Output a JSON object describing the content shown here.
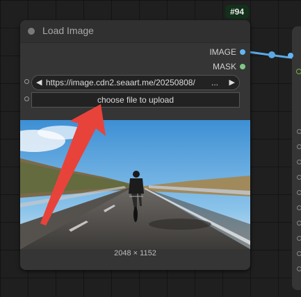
{
  "node": {
    "id_badge": "#94",
    "title": "Load Image",
    "outputs": [
      {
        "label": "IMAGE",
        "color": "#64b5f6"
      },
      {
        "label": "MASK",
        "color": "#81c784"
      }
    ],
    "image_combo": {
      "value": "https://image.cdn2.seaart.me/20250808/",
      "ellipsis": "...",
      "prev_arrow": "◀",
      "next_arrow": "▶"
    },
    "upload_button": "choose file to upload",
    "preview": {
      "dimensions_label": "2048 × 1152"
    }
  },
  "colors": {
    "canvas": "#1f1f1f",
    "node_body": "#353535",
    "node_header": "#303030",
    "badge_bg": "#12301a",
    "link": "#5aa9e6",
    "annotation_arrow": "#e8433a"
  }
}
